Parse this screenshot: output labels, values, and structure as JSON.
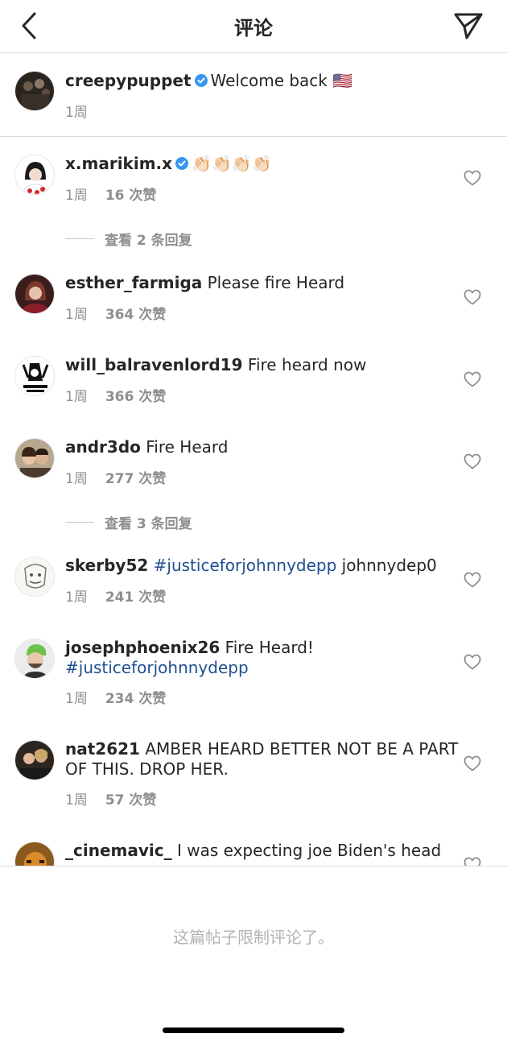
{
  "header": {
    "title": "评论"
  },
  "caption": {
    "username": "creepypuppet",
    "verified": true,
    "text": "Welcome back 🇺🇸",
    "time": "1周"
  },
  "comments": [
    {
      "username": "x.marikim.x",
      "verified": true,
      "text": "👏🏻👏🏻👏🏻👏🏻",
      "time": "1周",
      "likes": "16 次赞",
      "view_replies": "查看 2 条回复"
    },
    {
      "username": "esther_farmiga",
      "text": "Please fire Heard",
      "time": "1周",
      "likes": "364 次赞"
    },
    {
      "username": "will_balravenlord19",
      "text": "Fire heard now",
      "time": "1周",
      "likes": "366 次赞"
    },
    {
      "username": "andr3do",
      "text": "Fire Heard",
      "time": "1周",
      "likes": "277 次赞",
      "view_replies": "查看 3 条回复"
    },
    {
      "username": "skerby52",
      "hashtag": "#justiceforjohnnydepp",
      "text_after": "johnnydep0",
      "time": "1周",
      "likes": "241 次赞"
    },
    {
      "username": "josephphoenix26",
      "text": "Fire Heard!",
      "hashtag": "#justiceforjohnnydepp",
      "time": "1周",
      "likes": "234 次赞"
    },
    {
      "username": "nat2621",
      "text": "AMBER HEARD BETTER NOT BE A PART OF THIS. DROP HER.",
      "time": "1周",
      "likes": "57 次赞"
    },
    {
      "username": "_cinemavic_",
      "text": "I was expecting joe Biden's head"
    }
  ],
  "footer": {
    "text": "这篇帖子限制评论了。"
  },
  "icons": {
    "back": "chevron-left-icon",
    "send": "paper-plane-icon",
    "verified": "verified-badge-icon",
    "like": "heart-outline-icon"
  },
  "colors": {
    "verified": "#3897f0",
    "hashtag": "#1f4f91",
    "secondary_text": "#8e8e8e",
    "divider": "#dbdbdb"
  }
}
